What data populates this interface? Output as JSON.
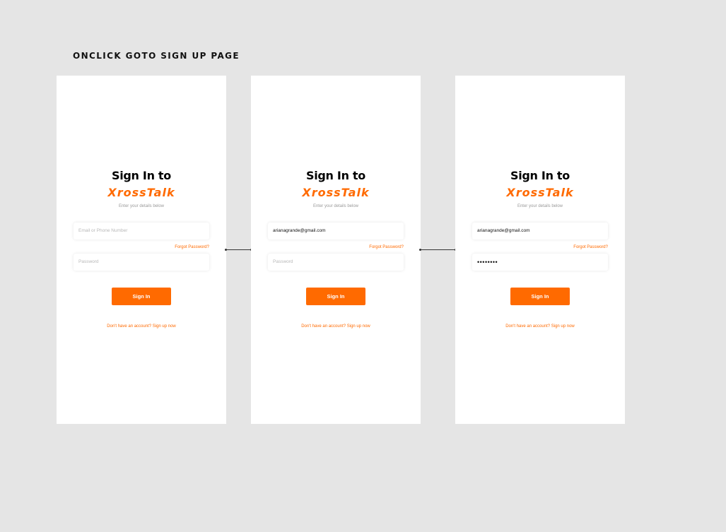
{
  "page": {
    "heading": "ONCLICK GOTO SIGN UP PAGE"
  },
  "colors": {
    "background": "#e5e5e5",
    "accent": "#ff6a00",
    "screen": "#ffffff"
  },
  "screens": [
    {
      "title": "Sign In to",
      "brand": "XrossTalk",
      "subtitle": "Enter your details below",
      "email_placeholder": "Email or Phone Number",
      "email_value": "",
      "forgot_label": "Forgot Password?",
      "password_placeholder": "Password",
      "password_value": "",
      "signin_label": "Sign In",
      "signup_text": "Don't have an account? Sign up now"
    },
    {
      "title": "Sign In to",
      "brand": "XrossTalk",
      "subtitle": "Enter your details below",
      "email_placeholder": "",
      "email_value": "arianagrande@gmail.com",
      "forgot_label": "Forgot Password?",
      "password_placeholder": "Password",
      "password_value": "",
      "signin_label": "Sign In",
      "signup_text": "Don't have an account? Sign up now"
    },
    {
      "title": "Sign In to",
      "brand": "XrossTalk",
      "subtitle": "Enter your details below",
      "email_placeholder": "",
      "email_value": "arianagrande@gmail.com",
      "forgot_label": "Forgot Password?",
      "password_placeholder": "",
      "password_value": "••••••••",
      "signin_label": "Sign In",
      "signup_text": "Don't have an account? Sign up now"
    }
  ]
}
